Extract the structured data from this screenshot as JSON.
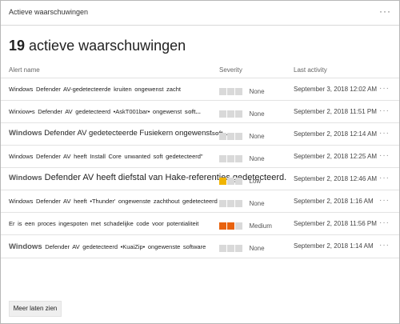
{
  "window": {
    "title": "Actieve waarschuwingen",
    "menu": "···"
  },
  "summary": {
    "count": "19",
    "label": "actieve waarschuwingen"
  },
  "columns": {
    "name": "Alert name",
    "severity": "Severity",
    "activity": "Last activity"
  },
  "alerts": [
    {
      "name": "Windows Defender AV-gedetecteerde kruiten ongewenst zacht",
      "severity": "None",
      "last_activity": "September 3, 2018 12:02 AM",
      "row_menu": "···"
    },
    {
      "name": "Wirxiow•s Defender AV gedetecteerd •AskT001bar• ongewenst",
      "extra": "soft...",
      "severity": "None",
      "last_activity": "September 2, 2018 11:51 PM",
      "row_menu": "···"
    },
    {
      "name_prefix": "Windows",
      "name": "Defender AV gedetecteerde Fusiekern ongewenst",
      "extra": "soft...",
      "severity": "None",
      "last_activity": "September 2, 2018 12:14 AM",
      "row_menu": "···"
    },
    {
      "name": "Windows Defender AV heeft Install Core unwanted soft gedetecteerd\"",
      "severity": "None",
      "last_activity": "September 2, 2018 12:25 AM",
      "row_menu": "···"
    },
    {
      "name_prefix": "Windows",
      "name": "Defender AV heeft diefstal van Hake-referenties gedetecteerd.",
      "severity": "Low",
      "last_activity": "September 2, 2018 12:46 AM",
      "row_menu": "···"
    },
    {
      "name": "Windows Defender AV heeft •Thunder' ongewenste zachthout gedetecteerd",
      "severity": "None",
      "last_activity": "September 2, 2018 1:16 AM",
      "row_menu": "···"
    },
    {
      "name": "Er is een proces ingespoten met schadelijke code voor potentialiteit",
      "severity": "Medium",
      "last_activity": "September 2, 2018 11:56 PM",
      "row_menu": "···"
    },
    {
      "name_prefix": "Windows",
      "name": "Defender AV gedetecteerd •KuaiZip• ongewenste software",
      "severity": "None",
      "last_activity": "September 2, 2018 1:14 AM",
      "row_menu": "···"
    }
  ],
  "footer": {
    "more_button": "Meer laten zien"
  },
  "colors": {
    "low": "#f0b400",
    "medium": "#e8620e",
    "none": "#d9d9d9"
  }
}
